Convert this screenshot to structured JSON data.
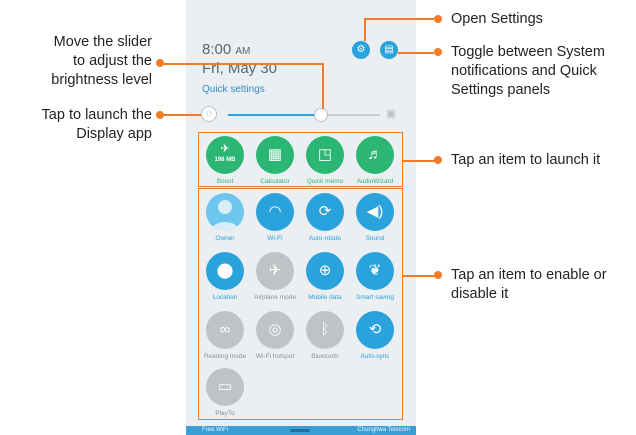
{
  "status": {
    "time": "8:00",
    "ampm": "AM",
    "date": "Fri, May 30",
    "quick_settings_label": "Quick settings"
  },
  "brightness": {
    "level": 0.61
  },
  "apps": [
    {
      "label": "Boost",
      "sub": "198 MB",
      "icon": "rocket-icon",
      "glyph": "✈"
    },
    {
      "label": "Calculator",
      "icon": "calculator-icon",
      "glyph": "▦"
    },
    {
      "label": "Quick memo",
      "icon": "memo-icon",
      "glyph": "◳"
    },
    {
      "label": "AudioWizard",
      "icon": "equalizer-icon",
      "glyph": "♬"
    }
  ],
  "toggles": [
    {
      "label": "Owner",
      "icon": "owner-avatar-icon",
      "state": "on"
    },
    {
      "label": "Wi-Fi",
      "icon": "wifi-icon",
      "glyph": "◠",
      "state": "on"
    },
    {
      "label": "Auto-rotate",
      "icon": "auto-rotate-icon",
      "glyph": "⟳",
      "state": "on"
    },
    {
      "label": "Sound",
      "icon": "sound-icon",
      "glyph": "◀)",
      "state": "on"
    },
    {
      "label": "Location",
      "icon": "location-icon",
      "glyph": "⬤",
      "state": "on"
    },
    {
      "label": "Airplane mode",
      "icon": "airplane-icon",
      "glyph": "✈",
      "state": "off"
    },
    {
      "label": "Mobile data",
      "icon": "mobile-data-icon",
      "glyph": "⊕",
      "state": "on"
    },
    {
      "label": "Smart saving",
      "icon": "leaf-icon",
      "glyph": "❦",
      "state": "on"
    },
    {
      "label": "Reading mode",
      "icon": "glasses-icon",
      "glyph": "∞",
      "state": "off"
    },
    {
      "label": "Wi-Fi hotspot",
      "icon": "hotspot-icon",
      "glyph": "◎",
      "state": "off"
    },
    {
      "label": "Bluetooth",
      "icon": "bluetooth-icon",
      "glyph": "ᛒ",
      "state": "off"
    },
    {
      "label": "Auto-sync",
      "icon": "sync-icon",
      "glyph": "⟲",
      "state": "on"
    },
    {
      "label": "PlayTo",
      "icon": "playto-icon",
      "glyph": "▭",
      "state": "off"
    }
  ],
  "navbar": {
    "left": "Free WiFi",
    "right": "Chunghwa Telecom"
  },
  "callouts": {
    "open_settings": "Open Settings",
    "toggle_panels": [
      "Toggle between System",
      "notifications and Quick",
      "Settings panels"
    ],
    "slider": [
      "Move the slider",
      "to adjust the",
      "brightness level"
    ],
    "display_app": [
      "Tap to launch the",
      "Display app"
    ],
    "launch_item": "Tap an item to launch it",
    "enable_item": [
      "Tap an item to enable or",
      "disable it"
    ]
  },
  "colors": {
    "accent_orange": "#f07c28",
    "blue": "#2aa2dc",
    "green": "#2bb673",
    "gray": "#bfc3c6"
  }
}
